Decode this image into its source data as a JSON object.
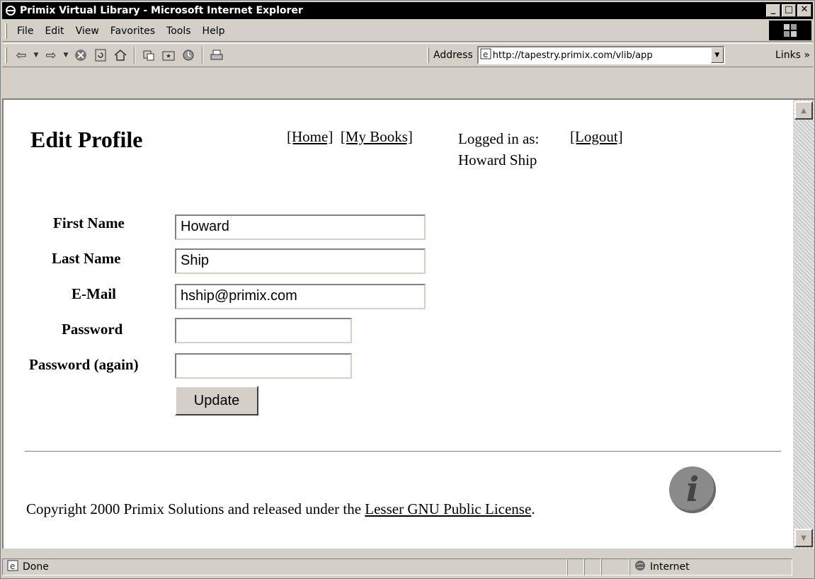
{
  "window": {
    "title": "Primix Virtual Library - Microsoft Internet Explorer",
    "min_label": "_",
    "max_label": "□",
    "close_label": "✕"
  },
  "menu": [
    "File",
    "Edit",
    "View",
    "Favorites",
    "Tools",
    "Help"
  ],
  "toolbar": {
    "address_label": "Address",
    "address_url": "http://tapestry.primix.com/vlib/app",
    "links_label": "Links »"
  },
  "page": {
    "title": "Edit Profile",
    "nav": {
      "home": "[Home]",
      "my_books": "[My Books]"
    },
    "logged_in_label": "Logged in as:",
    "user_name": "Howard Ship",
    "logout": "[Logout]"
  },
  "form": {
    "first_name_label": "First Name",
    "first_name_value": "Howard",
    "last_name_label": "Last Name",
    "last_name_value": "Ship",
    "email_label": "E-Mail",
    "email_value": "hship@primix.com",
    "password_label": "Password",
    "password_value": "",
    "password_again_label": "Password (again)",
    "password_again_value": "",
    "submit_label": "Update"
  },
  "footer": {
    "text": "Copyright 2000 Primix Solutions and released under the",
    "license_link": "Lesser GNU Public License",
    "period": "."
  },
  "status": {
    "text": "Done",
    "zone": "Internet"
  }
}
